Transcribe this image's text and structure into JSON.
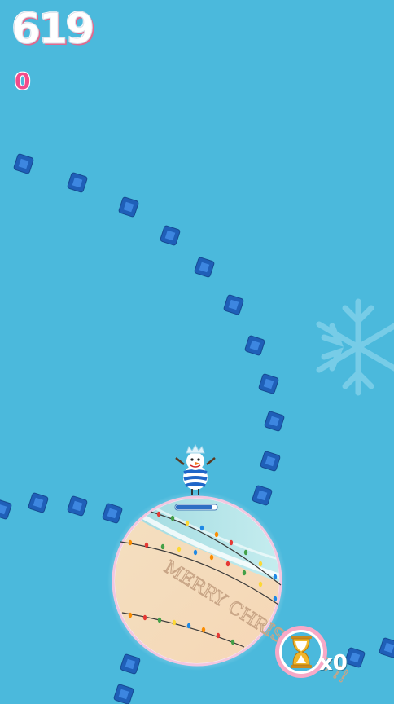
{
  "hud": {
    "score": "619",
    "gems": "0"
  },
  "powerup": {
    "icon": "hourglass-icon",
    "count_label": "x0",
    "count": 0
  },
  "player": {
    "icon": "snowman-icon",
    "charge_level": 0.9
  },
  "planet": {
    "sand_text": "MERRY CHRISTMAS !!"
  },
  "colors": {
    "sky": "#4bb9dc",
    "gem": "#1f5fb8",
    "score_outline": "#e06a8e",
    "gem_count": "#f34b8a"
  }
}
